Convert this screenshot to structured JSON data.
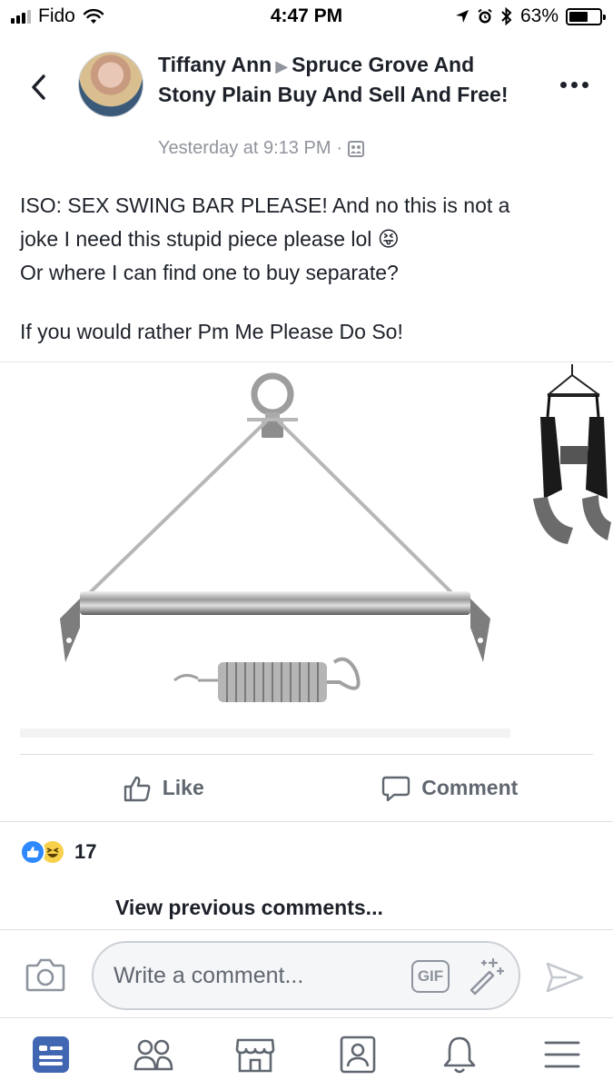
{
  "status_bar": {
    "carrier": "Fido",
    "time": "4:47 PM",
    "battery_percent": "63%",
    "battery_level": 0.63,
    "icons": [
      "signal-icon",
      "wifi-icon",
      "location-icon",
      "alarm-icon",
      "bluetooth-icon",
      "battery-icon"
    ]
  },
  "post": {
    "author": "Tiffany Ann",
    "group": "Spruce Grove And Stony Plain Buy And Sell And Free!",
    "timestamp": "Yesterday at 9:13 PM",
    "separator": "·",
    "body_line1": "ISO: SEX SWING BAR PLEASE! And no this is not a",
    "body_line2": "joke I need this stupid piece please lol",
    "body_emoji": "😝",
    "body_line3": "Or where I can find one to buy separate?",
    "body_line4": "If you would rather Pm Me Please Do So!"
  },
  "actions": {
    "like_label": "Like",
    "comment_label": "Comment"
  },
  "reactions": {
    "count": "17",
    "types": [
      "like",
      "haha"
    ]
  },
  "comments": {
    "view_previous": "View previous comments..."
  },
  "composer": {
    "placeholder": "Write a comment...",
    "gif_label": "GIF"
  },
  "tab_bar": {
    "tabs": [
      "news-feed",
      "friends",
      "marketplace",
      "profile",
      "notifications",
      "menu"
    ]
  },
  "colors": {
    "accent": "#4267b2",
    "text": "#1d2129",
    "secondary_text": "#90949c",
    "like_blue": "#2e89ff",
    "haha_yellow": "#f7d14a"
  }
}
